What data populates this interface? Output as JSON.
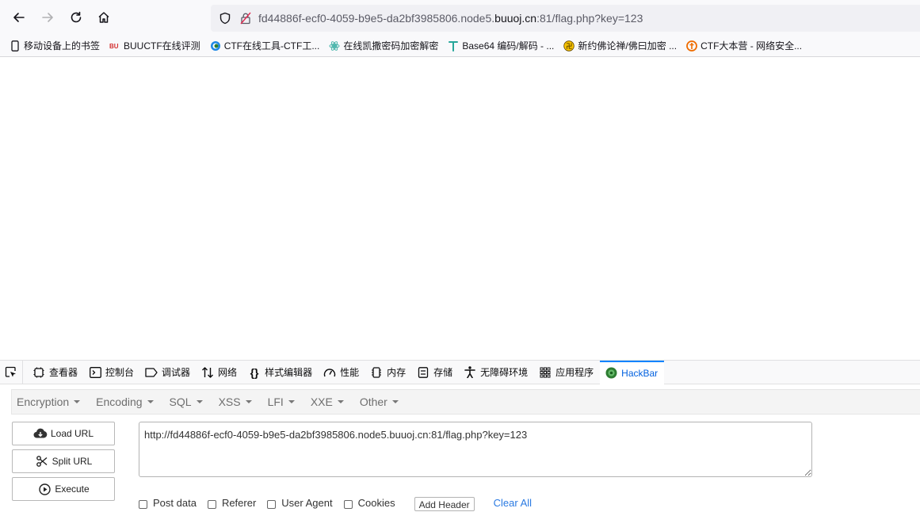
{
  "browser": {
    "url_prefix": "fd44886f-ecf0-4059-b9e5-da2bf3985806.node5.",
    "url_domain": "buuoj.cn",
    "url_suffix": ":81/flag.php?key=123"
  },
  "bookmarks": [
    {
      "label": "移动设备上的书签",
      "icon": "mobile-icon"
    },
    {
      "label": "BUUCTF在线评测",
      "icon": "buuctf-icon"
    },
    {
      "label": "CTF在线工具-CTF工...",
      "icon": "ctf-tools-icon"
    },
    {
      "label": "在线凯撒密码加密解密",
      "icon": "caesar-icon"
    },
    {
      "label": "Base64 编码/解码 - ...",
      "icon": "base64-icon"
    },
    {
      "label": "新约佛论禅/佛曰加密 ...",
      "icon": "buddha-icon"
    },
    {
      "label": "CTF大本营 - 网络安全...",
      "icon": "ctf-camp-icon"
    }
  ],
  "devtools": {
    "tabs": [
      {
        "label": "查看器",
        "icon": "inspector-icon"
      },
      {
        "label": "控制台",
        "icon": "console-icon"
      },
      {
        "label": "调试器",
        "icon": "debugger-icon"
      },
      {
        "label": "网络",
        "icon": "network-icon"
      },
      {
        "label": "样式编辑器",
        "icon": "style-editor-icon"
      },
      {
        "label": "性能",
        "icon": "performance-icon"
      },
      {
        "label": "内存",
        "icon": "memory-icon"
      },
      {
        "label": "存储",
        "icon": "storage-icon"
      },
      {
        "label": "无障碍环境",
        "icon": "accessibility-icon"
      },
      {
        "label": "应用程序",
        "icon": "application-icon"
      },
      {
        "label": "HackBar",
        "icon": "hackbar-icon"
      }
    ],
    "active_tab": "HackBar"
  },
  "hackbar": {
    "menu": [
      "Encryption",
      "Encoding",
      "SQL",
      "XSS",
      "LFI",
      "XXE",
      "Other"
    ],
    "load_url": "Load URL",
    "split_url": "Split URL",
    "execute": "Execute",
    "url_value": "http://fd44886f-ecf0-4059-b9e5-da2bf3985806.node5.buuoj.cn:81/flag.php?key=123",
    "options": [
      "Post data",
      "Referer",
      "User Agent",
      "Cookies"
    ],
    "add_header": "Add Header",
    "clear_all": "Clear All"
  },
  "colors": {
    "active_tab": "#0060df",
    "accent": "#0a84ff",
    "link": "#2a7ae2"
  }
}
